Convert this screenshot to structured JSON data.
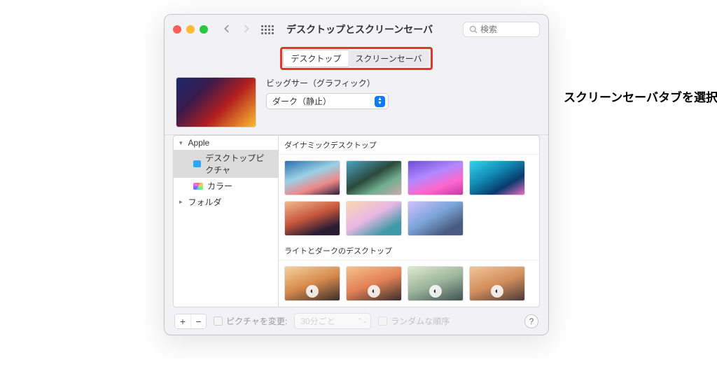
{
  "window_title": "デスクトップとスクリーンセーバ",
  "search_placeholder": "検索",
  "tabs": {
    "desktop": "デスクトップ",
    "screensaver": "スクリーンセーバ"
  },
  "annotation": "スクリーンセーバタブを選択",
  "preview": {
    "title": "ビッグサー（グラフィック）",
    "mode": "ダーク（静止）"
  },
  "sidebar": {
    "group_apple": "Apple",
    "item_desktop_pictures": "デスクトップピクチャ",
    "item_colors": "カラー",
    "group_folder": "フォルダ"
  },
  "sections": {
    "dynamic": "ダイナミックデスクトップ",
    "light_dark": "ライトとダークのデスクトップ"
  },
  "footer": {
    "change_picture": "ピクチャを変更:",
    "interval": "30分ごと",
    "random_order": "ランダムな順序",
    "add": "+",
    "remove": "−",
    "help": "?"
  }
}
